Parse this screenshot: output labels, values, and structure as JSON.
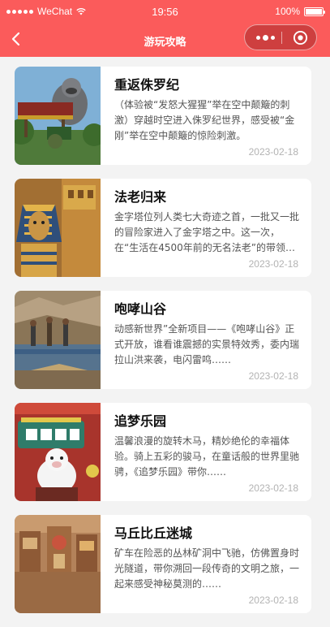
{
  "status_bar": {
    "carrier": "WeChat",
    "time": "19:56",
    "battery": "100%"
  },
  "nav": {
    "title": "游玩攻略",
    "back_icon": "chevron-left-icon",
    "more_icon": "more-dots-icon",
    "close_icon": "target-circle-icon"
  },
  "colors": {
    "brand": "#fb5b5b",
    "page_bg": "#f3f3f3",
    "date": "#b3b3b3"
  },
  "articles": [
    {
      "title": "重返侏罗纪",
      "desc": "（体验被“发怒大猩猩”举在空中颠簸的刺激）穿越时空进入侏罗纪世界，感受被“金刚”举在空中颠簸的惊险刺激。",
      "date": "2023-02-18"
    },
    {
      "title": "法老归来",
      "desc": "金字塔位列人类七大奇迹之首，一批又一批的冒险家进入了金字塔之中。这一次，在“生活在4500年前的无名法老”的带领下……",
      "date": "2023-02-18"
    },
    {
      "title": "咆哮山谷",
      "desc": "动感新世界”全新项目——《咆哮山谷》正式开放，谁看谁震撼的实景特效秀，委内瑞拉山洪来袭，电闪雷鸣……",
      "date": "2023-02-18"
    },
    {
      "title": "追梦乐园",
      "desc": "温馨浪漫的旋转木马，精妙绝伦的幸福体验。骑上五彩的骏马，在童话般的世界里驰骋，《追梦乐园》带你……",
      "date": "2023-02-18"
    },
    {
      "title": "马丘比丘迷城",
      "desc": "矿车在险恶的丛林矿洞中飞驰，仿佛置身时光隧道，带你溯回一段传奇的文明之旅，一起来感受神秘莫测的……",
      "date": "2023-02-18"
    }
  ]
}
